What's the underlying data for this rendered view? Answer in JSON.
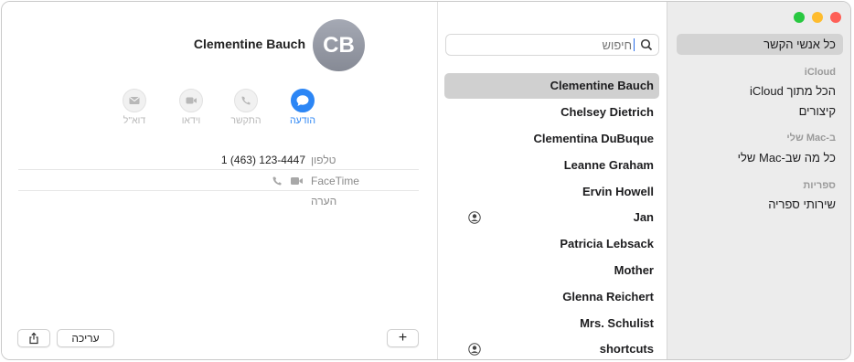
{
  "sidebar": {
    "all_contacts": "כל אנשי הקשר",
    "section_icloud": "iCloud",
    "all_icloud": "הכל מתוך iCloud",
    "shortcuts": "קיצורים",
    "section_mac": "ב-Mac שלי",
    "all_on_mac": "כל מה שב-Mac שלי",
    "section_libraries": "ספריות",
    "library_services": "שירותי ספריה"
  },
  "search": {
    "placeholder": "חיפוש"
  },
  "contacts": [
    "Clementine Bauch",
    "Chelsey Dietrich",
    "Clementina DuBuque",
    "Leanne Graham",
    "Ervin Howell",
    "Jan",
    "Patricia Lebsack",
    "Mother",
    "Glenna Reichert",
    "Mrs. Schulist",
    "shortcuts"
  ],
  "detail": {
    "initials": "CB",
    "name": "Clementine Bauch",
    "actions": {
      "message": "הודעה",
      "call": "התקשר",
      "video": "וידאו",
      "mail": "דוא\"ל"
    },
    "phone_label": "טלפון",
    "phone_value": "1 (463) 123-4447",
    "facetime_label": "FaceTime",
    "note_label": "הערה",
    "edit_button": "עריכה",
    "add_button": "+"
  },
  "colors": {
    "accent": "#2c86f5",
    "close": "#fe5f57",
    "minimize": "#febc2e",
    "zoom": "#28c840"
  }
}
